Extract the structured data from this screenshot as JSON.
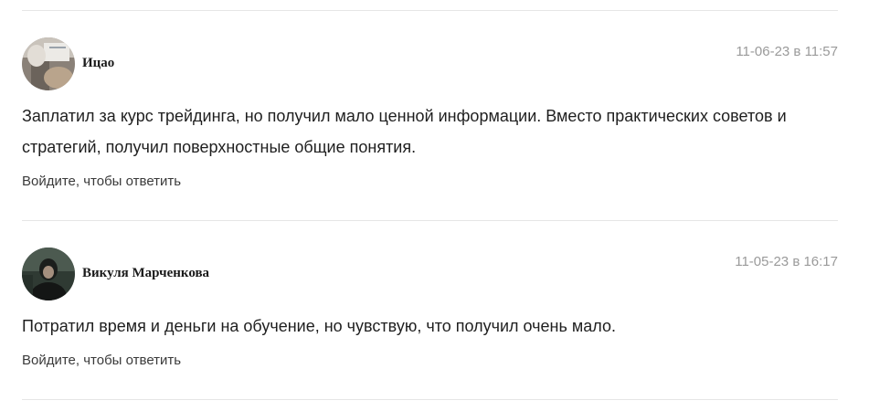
{
  "comments": [
    {
      "author": "Ицао",
      "date": "11-06-23 в 11:57",
      "text": "Заплатил за курс трейдинга, но получил мало ценной информации. Вместо практических советов и стратегий, получил поверхностные общие понятия.",
      "reply_label": "Войдите, чтобы ответить",
      "avatar_icon": "avatar-photo-icon"
    },
    {
      "author": "Викуля Марченкова",
      "date": "11-05-23 в 16:17",
      "text": "Потратил время и деньги на обучение, но чувствую, что получил очень мало.",
      "reply_label": "Войдите, чтобы ответить",
      "avatar_icon": "avatar-photo-icon"
    }
  ],
  "colors": {
    "divider": "#e6e6e6",
    "date": "#9a9a9a",
    "text": "#1f1f1f",
    "author": "#1a1a1a"
  }
}
